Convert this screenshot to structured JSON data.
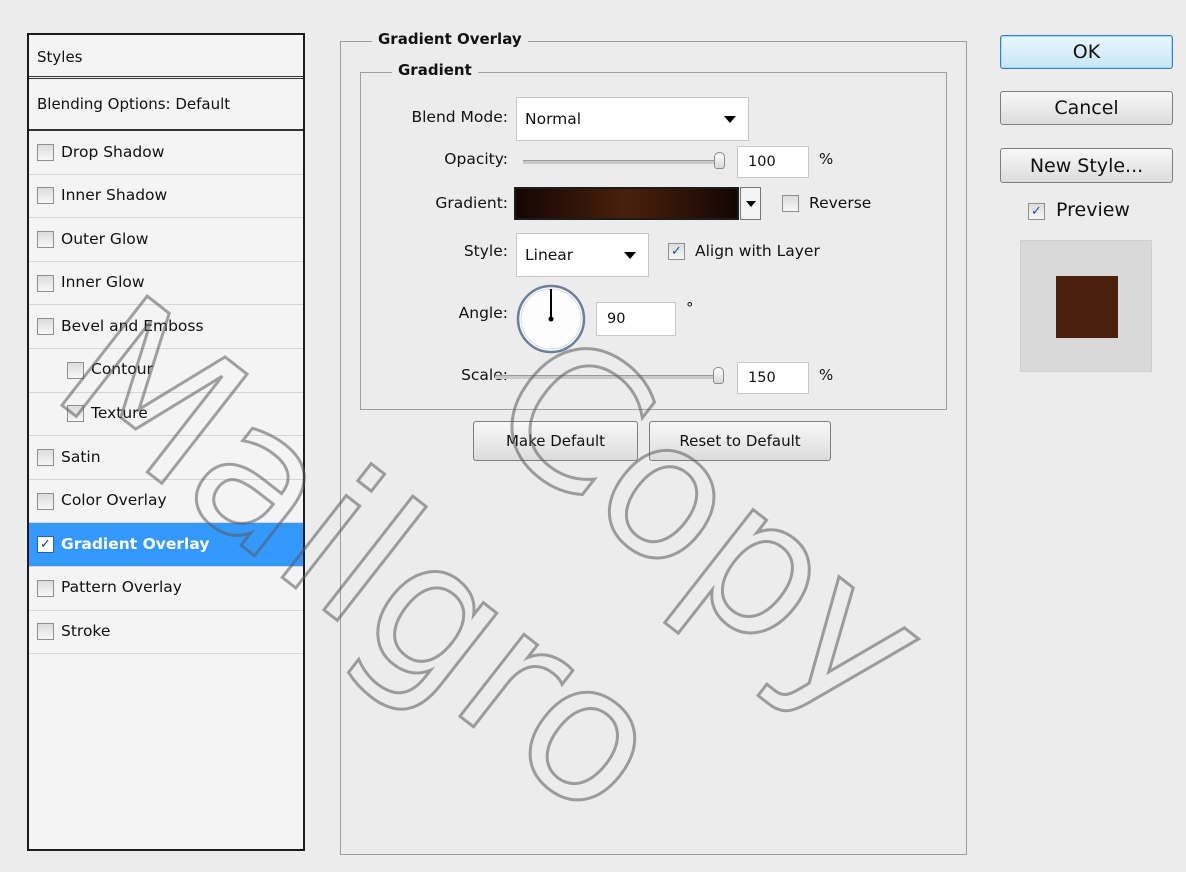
{
  "styles_panel": {
    "header": "Styles",
    "blending_options": "Blending Options: Default",
    "items": [
      {
        "label": "Drop Shadow",
        "checked": false,
        "indent": false,
        "selected": false
      },
      {
        "label": "Inner Shadow",
        "checked": false,
        "indent": false,
        "selected": false
      },
      {
        "label": "Outer Glow",
        "checked": false,
        "indent": false,
        "selected": false
      },
      {
        "label": "Inner Glow",
        "checked": false,
        "indent": false,
        "selected": false
      },
      {
        "label": "Bevel and Emboss",
        "checked": false,
        "indent": false,
        "selected": false
      },
      {
        "label": "Contour",
        "checked": false,
        "indent": true,
        "selected": false
      },
      {
        "label": "Texture",
        "checked": false,
        "indent": true,
        "selected": false
      },
      {
        "label": "Satin",
        "checked": false,
        "indent": false,
        "selected": false
      },
      {
        "label": "Color Overlay",
        "checked": false,
        "indent": false,
        "selected": false
      },
      {
        "label": "Gradient Overlay",
        "checked": true,
        "indent": false,
        "selected": true
      },
      {
        "label": "Pattern Overlay",
        "checked": false,
        "indent": false,
        "selected": false
      },
      {
        "label": "Stroke",
        "checked": false,
        "indent": false,
        "selected": false
      }
    ]
  },
  "gradient_overlay": {
    "section_title": "Gradient Overlay",
    "group_title": "Gradient",
    "blend_mode_label": "Blend Mode:",
    "blend_mode_value": "Normal",
    "opacity_label": "Opacity:",
    "opacity_value": "100",
    "opacity_unit": "%",
    "opacity_fraction": 1.0,
    "gradient_label": "Gradient:",
    "gradient_colors": [
      "#140604",
      "#4a200c",
      "#140604"
    ],
    "reverse_label": "Reverse",
    "reverse_checked": false,
    "style_label": "Style:",
    "style_value": "Linear",
    "align_label": "Align with Layer",
    "align_checked": true,
    "angle_label": "Angle:",
    "angle_value": "90",
    "angle_unit": "°",
    "angle_degrees": 90,
    "scale_label": "Scale:",
    "scale_value": "150",
    "scale_unit": "%",
    "scale_fraction": 1.0,
    "make_default_label": "Make Default",
    "reset_default_label": "Reset to Default"
  },
  "actions": {
    "ok_label": "OK",
    "cancel_label": "Cancel",
    "new_style_label": "New Style...",
    "preview_label": "Preview",
    "preview_checked": true,
    "preview_swatch_color": "#4a200c"
  },
  "watermark": {
    "text_1": "Mailgro",
    "text_2": "Copy"
  },
  "colors": {
    "selection": "#3399ff",
    "window_bg": "#ececec",
    "check": "#1a4fa8"
  }
}
